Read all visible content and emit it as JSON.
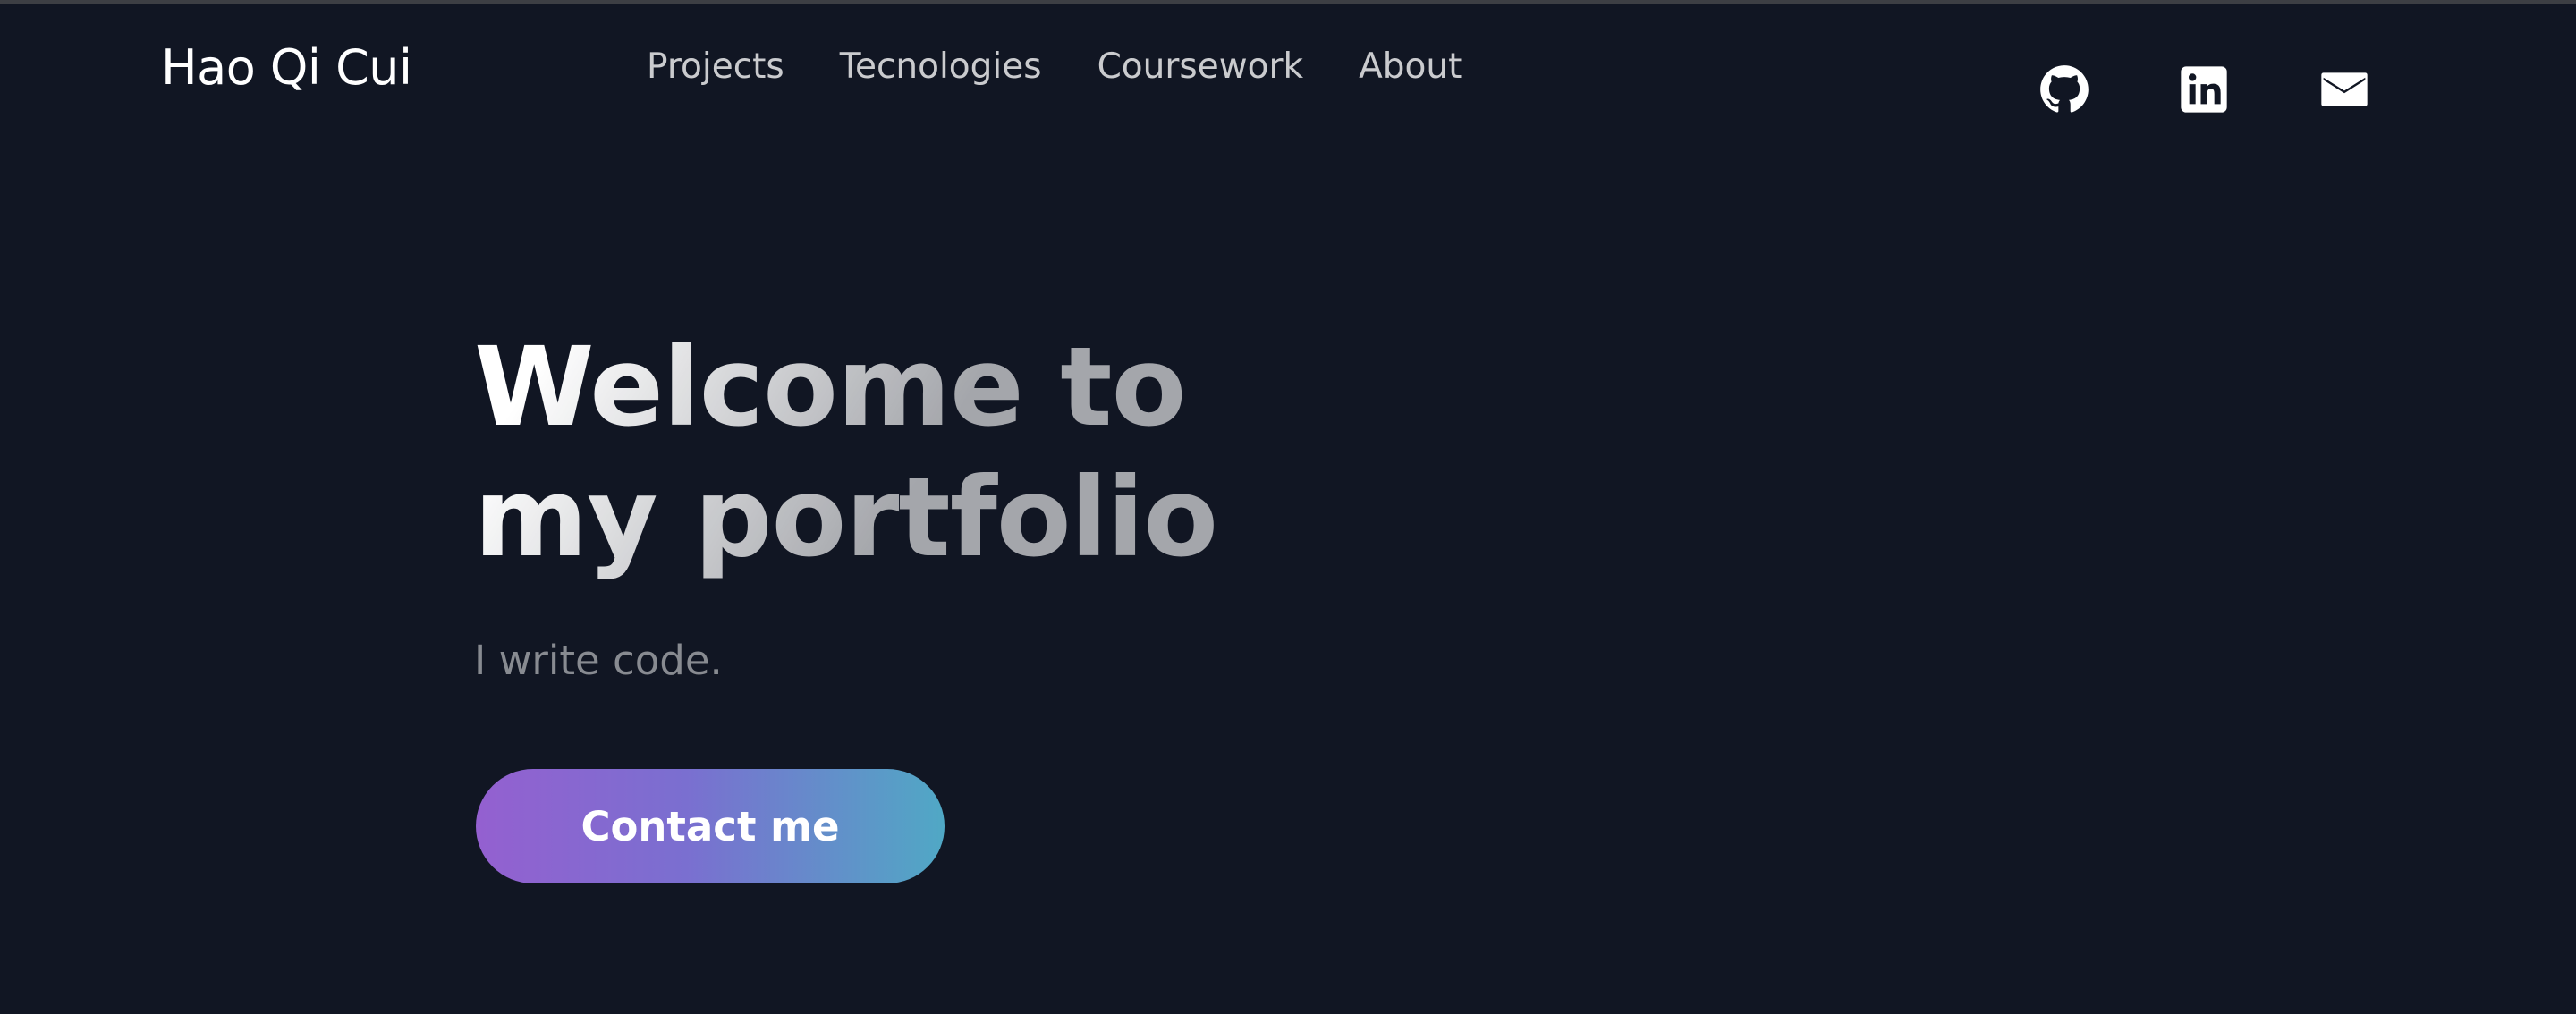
{
  "header": {
    "brand": "Hao Qi Cui",
    "nav": [
      {
        "label": "Projects"
      },
      {
        "label": "Tecnologies"
      },
      {
        "label": "Coursework"
      },
      {
        "label": "About"
      }
    ],
    "social": [
      {
        "icon": "github-icon"
      },
      {
        "icon": "linkedin-icon"
      },
      {
        "icon": "mail-icon"
      }
    ]
  },
  "hero": {
    "title_line1": "Welcome to",
    "title_line2": "my portfolio",
    "subtitle": "I write code.",
    "cta_label": "Contact me"
  },
  "colors": {
    "background": "#111623",
    "cta_gradient_start": "#9460d0",
    "cta_gradient_end": "#50a8c5",
    "text": "#ffffff"
  }
}
